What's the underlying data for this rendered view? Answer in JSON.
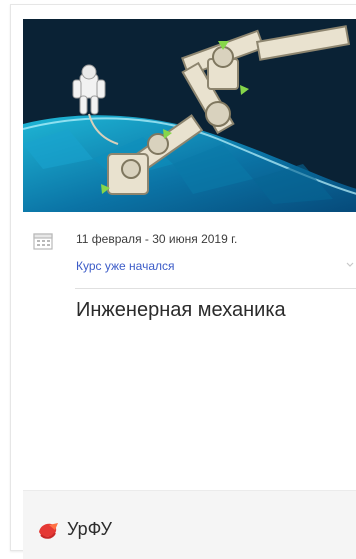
{
  "course": {
    "date_range": "11 февраля - 30 июня 2019 г.",
    "status": "Курс уже начался",
    "title": "Инженерная механика",
    "organization": "УрФУ",
    "icons": {
      "calendar": "calendar-icon",
      "dropdown": "chevron-down-icon",
      "logo": "urfu-logo"
    },
    "colors": {
      "status": "#3c5cc8",
      "logo": "#e53935"
    }
  }
}
